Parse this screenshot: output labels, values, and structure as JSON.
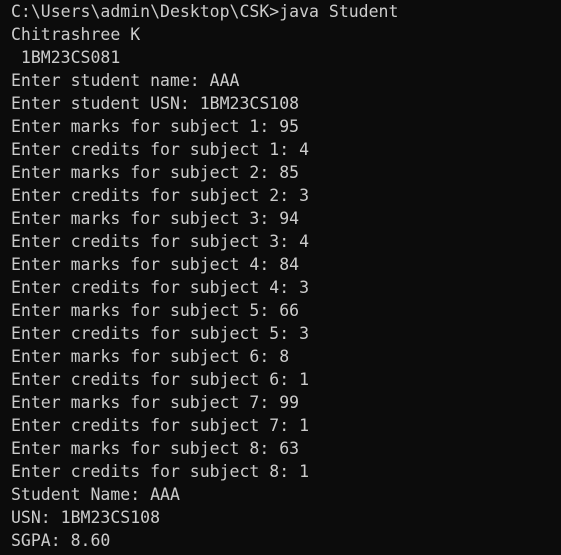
{
  "terminal": {
    "background": "#0c0c0c",
    "foreground": "#cccccc",
    "lines": [
      "C:\\Users\\admin\\Desktop\\CSK>java Student",
      "Chitrashree K",
      " 1BM23CS081",
      "Enter student name: AAA",
      "Enter student USN: 1BM23CS108",
      "Enter marks for subject 1: 95",
      "Enter credits for subject 1: 4",
      "Enter marks for subject 2: 85",
      "Enter credits for subject 2: 3",
      "Enter marks for subject 3: 94",
      "Enter credits for subject 3: 4",
      "Enter marks for subject 4: 84",
      "Enter credits for subject 4: 3",
      "Enter marks for subject 5: 66",
      "Enter credits for subject 5: 3",
      "Enter marks for subject 6: 8",
      "Enter credits for subject 6: 1",
      "Enter marks for subject 7: 99",
      "Enter credits for subject 7: 1",
      "Enter marks for subject 8: 63",
      "Enter credits for subject 8: 1",
      "Student Name: AAA",
      "USN: 1BM23CS108",
      "SGPA: 8.60"
    ]
  }
}
